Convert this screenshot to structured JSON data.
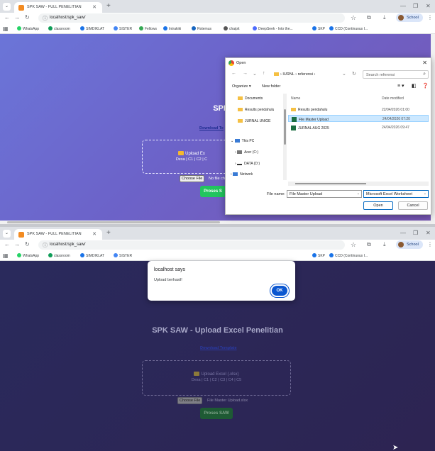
{
  "browser": {
    "tab_title": "SPK SAW - FULL PENELITIAN",
    "url": "localhost/spk_saw/",
    "profile_label": "School",
    "bookmarks": [
      "WhatsApp",
      "classroom",
      "SIMDIKLAT",
      "SISTER",
      "Fellows",
      "Intrakiki",
      "Rotemus",
      "chaipit",
      "DeepSeek - Into the...",
      "SKP",
      "CCD (Continuous I..."
    ]
  },
  "top": {
    "app_title": "SPK SAW - Upload",
    "download_link": "Download Te",
    "dropzone_label": "Upload Ex",
    "dropzone_cols": "Desa | C1 | C2 | C",
    "choose_file": "Choose File",
    "file_status": "No file ch",
    "proses_label": "Proses S",
    "open_dialog": {
      "title": "Open",
      "path": [
        "IURNL",
        "referensi"
      ],
      "search_placeholder": "Search referensi",
      "organize": "Organize ▾",
      "new_folder": "New folder",
      "tree": [
        "Documents",
        "Results pendahulu",
        "JURNAL UNIGE",
        "This PC",
        "Acer (C:)",
        "DATA (D:)",
        "Network"
      ],
      "col_name": "Name",
      "col_date": "Date modified",
      "files": [
        {
          "name": "Results pendahulu",
          "date": "22/04/2026 01:00"
        },
        {
          "name": "File Master Upload",
          "date": "24/04/2026 07:20"
        },
        {
          "name": "JURNAL AUG 2025",
          "date": "24/04/2026 09:47"
        }
      ],
      "file_name_label": "File name:",
      "file_name_value": "File Master Upload",
      "file_type": "Microsoft Excel Worksheet",
      "open_btn": "Open",
      "cancel_btn": "Cancel"
    }
  },
  "bottom": {
    "alert_title": "localhost says",
    "alert_msg": "Upload berhasil!",
    "alert_ok": "OK",
    "app_title": "SPK SAW - Upload Excel Penelitian",
    "download_link": "Download Template",
    "dropzone_label": "Upload Excel (.xlsx)",
    "dropzone_cols": "Desa | C1 | C2 | C3 | C4 | C5",
    "choose_file": "Choose File",
    "file_status": "File Master Upload.xlsx",
    "proses_label": "Proses SAW"
  },
  "colors": {
    "top_gradient": "#6b75d8",
    "bottom_bg": "#2a2a5c",
    "proses_green": "#22c55e",
    "alert_ok": "#0b57d0"
  }
}
